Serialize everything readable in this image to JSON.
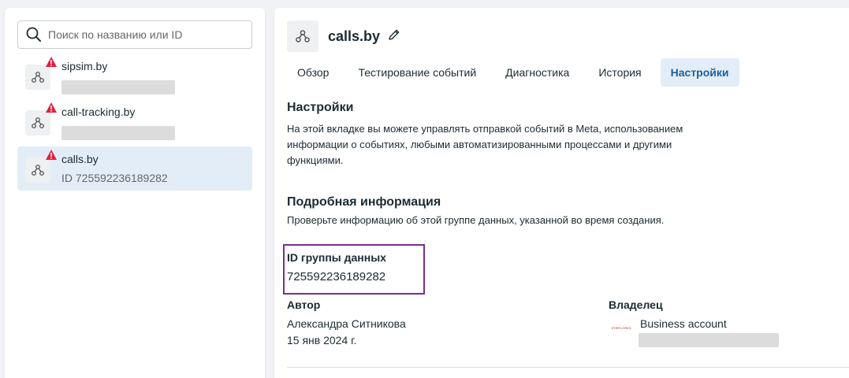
{
  "sidebar": {
    "search_placeholder": "Поиск по названию или ID",
    "items": [
      {
        "name": "sipsim.by",
        "sub": ""
      },
      {
        "name": "call-tracking.by",
        "sub": ""
      },
      {
        "name": "calls.by",
        "sub": "ID 725592236189282"
      }
    ]
  },
  "main": {
    "title": "calls.by",
    "tabs": [
      {
        "label": "Обзор"
      },
      {
        "label": "Тестирование событий"
      },
      {
        "label": "Диагностика"
      },
      {
        "label": "История"
      },
      {
        "label": "Настройки"
      }
    ],
    "settings_heading": "Настройки",
    "settings_desc_lines": [
      "На этой вкладке вы можете управлять отправкой событий в Meta, использованием",
      "информации о событиях, любыми автоматизированными процессами и другими",
      "функциями."
    ],
    "details_heading": "Подробная информация",
    "details_desc": "Проверьте информацию об этой группе данных, указанной во время создания.",
    "dataset_id_label": "ID группы данных",
    "dataset_id_value": "725592236189282",
    "author_label": "Автор",
    "author_name": "Александра Ситникова",
    "author_date": "15 янв 2024 г.",
    "owner_label": "Владелец",
    "owner_name": "Business account",
    "owner_logo_text": "STIRFLORES"
  },
  "colors": {
    "accent": "#1d5f9c",
    "selected_bg": "#e3edf7",
    "highlight_border": "#7b2d8e",
    "warning": "#e41e3f"
  },
  "icons": [
    "search-icon",
    "dataset-icon",
    "warning-icon",
    "pencil-icon"
  ]
}
